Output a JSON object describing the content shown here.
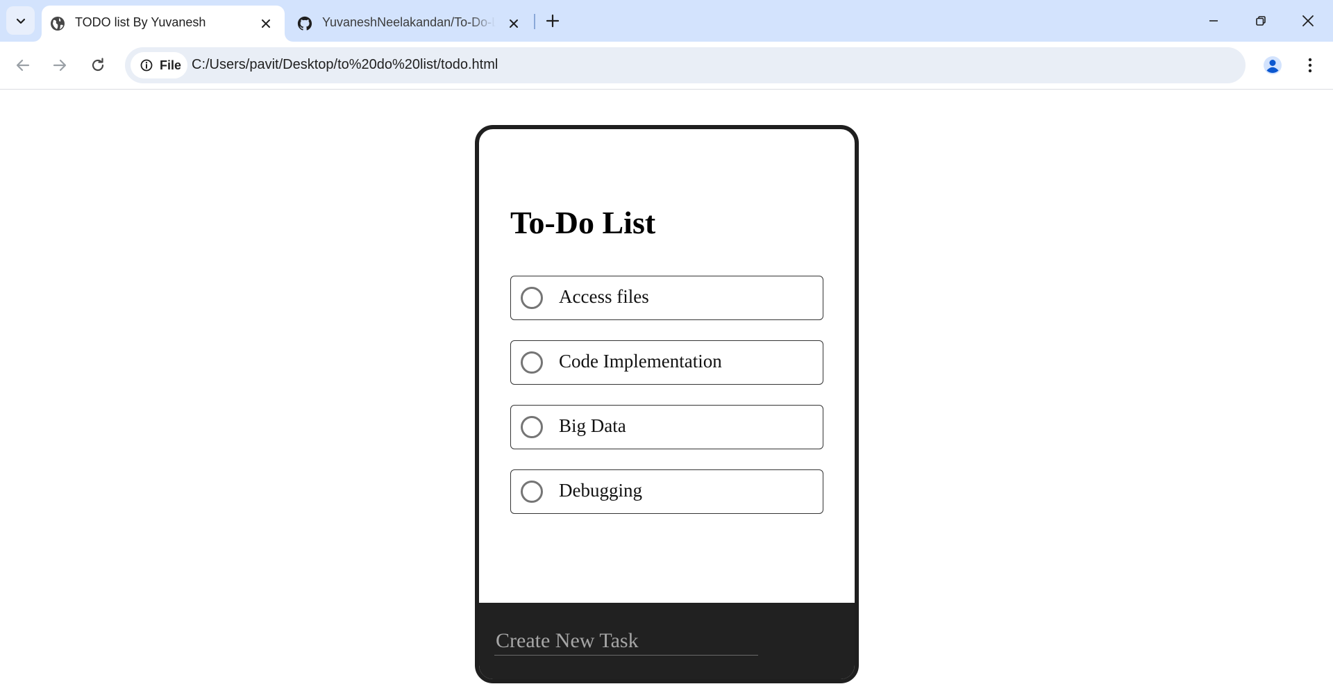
{
  "browser": {
    "tabs": [
      {
        "title": "TODO list By Yuvanesh",
        "active": true,
        "icon": "globe-icon"
      },
      {
        "title": "YuvaneshNeelakandan/To-Do-List",
        "active": false,
        "icon": "github-icon"
      }
    ],
    "address": {
      "chip_label": "File",
      "url": "C:/Users/pavit/Desktop/to%20do%20list/todo.html"
    }
  },
  "app": {
    "title": "To-Do List",
    "tasks": [
      {
        "label": "Access files",
        "done": false
      },
      {
        "label": "Code Implementation",
        "done": false
      },
      {
        "label": "Big Data",
        "done": false
      },
      {
        "label": "Debugging",
        "done": false
      }
    ],
    "new_task_placeholder": "Create New Task"
  },
  "colors": {
    "tabstrip": "#d3e3fd",
    "omnibox": "#e9eef6",
    "card_border": "#1f1f1f",
    "footer": "#212121"
  }
}
